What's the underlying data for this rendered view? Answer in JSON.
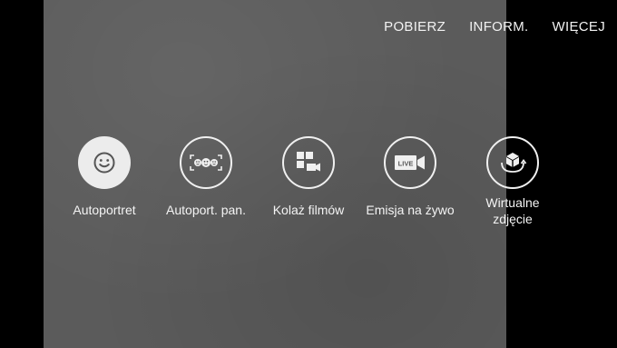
{
  "top_menu": {
    "download": "POBIERZ",
    "info": "INFORM.",
    "more": "WIĘCEJ"
  },
  "modes": [
    {
      "label": "Autoportret",
      "icon": "selfie-face-icon",
      "selected": true
    },
    {
      "label": "Autoport. pan.",
      "icon": "panorama-selfie-icon",
      "selected": false
    },
    {
      "label": "Kolaż filmów",
      "icon": "video-collage-icon",
      "selected": false
    },
    {
      "label": "Emisja na żywo",
      "icon": "live-broadcast-icon",
      "selected": false,
      "badge": "LIVE"
    },
    {
      "label_line1": "Wirtualne",
      "label_line2": "zdjęcie",
      "icon": "virtual-shot-icon",
      "selected": false
    }
  ],
  "colors": {
    "viewfinder": "#5b5b5b",
    "background": "#000000",
    "icon_fill": "#ececec"
  }
}
